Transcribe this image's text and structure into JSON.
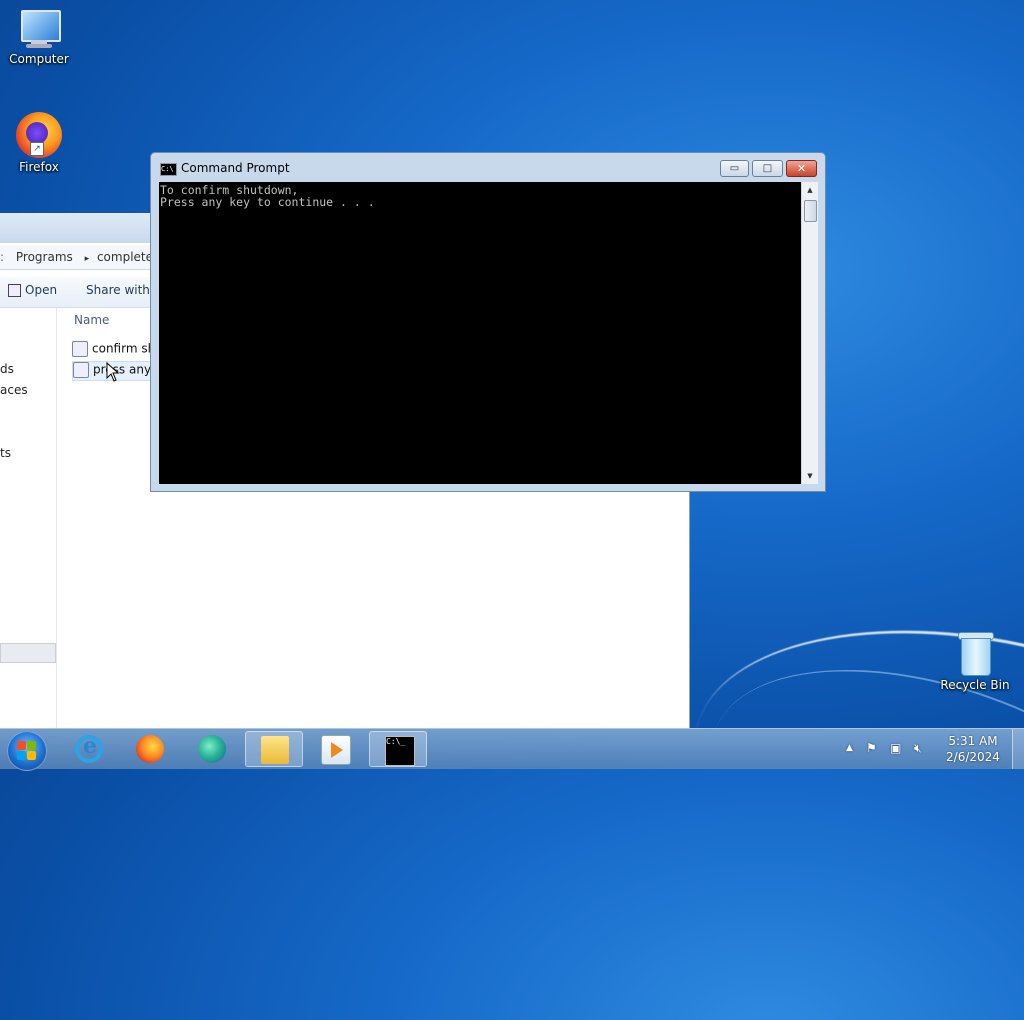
{
  "desktop": {
    "icons": {
      "computer": "Computer",
      "firefox": "Firefox",
      "recycle_bin": "Recycle Bin"
    }
  },
  "explorer": {
    "breadcrumb": [
      "Programs",
      "completely f"
    ],
    "breadcrumb_sep": "▸",
    "toolbar": {
      "open": "Open",
      "share_with": "Share with ▾"
    },
    "nav_fragments": [
      "ds",
      "aces",
      "ts"
    ],
    "column_name": "Name",
    "files": [
      "confirm sh",
      "press any k"
    ]
  },
  "cmd": {
    "title": "Command Prompt",
    "icon_text": "C:\\",
    "console_lines": [
      "To confirm shutdown,",
      "Press any key to continue . . ."
    ],
    "buttons": {
      "minimize": "▭",
      "maximize": "□",
      "close": "✕"
    }
  },
  "taskbar": {
    "clock_time": "5:31 AM",
    "clock_date": "2/6/2024",
    "tray_arrow": "▲",
    "cmd_icon_text": "C:\\_"
  }
}
